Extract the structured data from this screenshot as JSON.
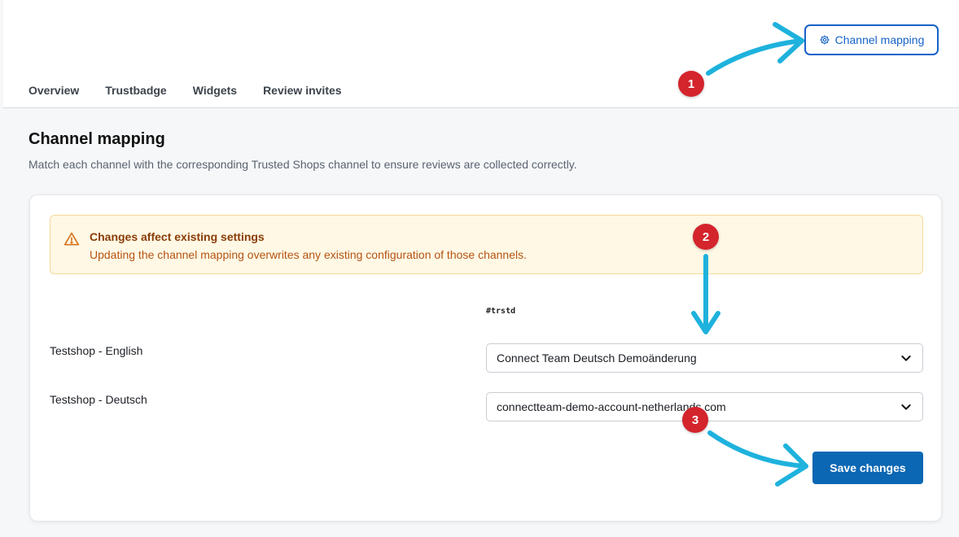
{
  "header": {
    "channel_mapping_button": "Channel mapping",
    "tabs": [
      {
        "label": "Overview"
      },
      {
        "label": "Trustbadge"
      },
      {
        "label": "Widgets"
      },
      {
        "label": "Review invites"
      }
    ]
  },
  "page": {
    "title": "Channel mapping",
    "description": "Match each channel with the corresponding Trusted Shops channel to ensure reviews are collected correctly."
  },
  "alert": {
    "title": "Changes affect existing settings",
    "text": "Updating the channel mapping overwrites any existing configuration of those channels."
  },
  "mapping": {
    "column_header": "#trstd",
    "rows": [
      {
        "channel": "Testshop - English",
        "selected": "Connect Team Deutsch Demoänderung"
      },
      {
        "channel": "Testshop - Deutsch",
        "selected": "connectteam-demo-account-netherlands.com"
      }
    ],
    "save_label": "Save changes"
  },
  "annotations": {
    "markers": [
      "1",
      "2",
      "3"
    ],
    "marker_color": "#d4242c",
    "arrow_color": "#1eb2dd"
  },
  "colors": {
    "accent": "#1762c9",
    "primary_button": "#0b67b3",
    "warning_bg": "#fff8e5",
    "warning_text": "#b55413"
  }
}
